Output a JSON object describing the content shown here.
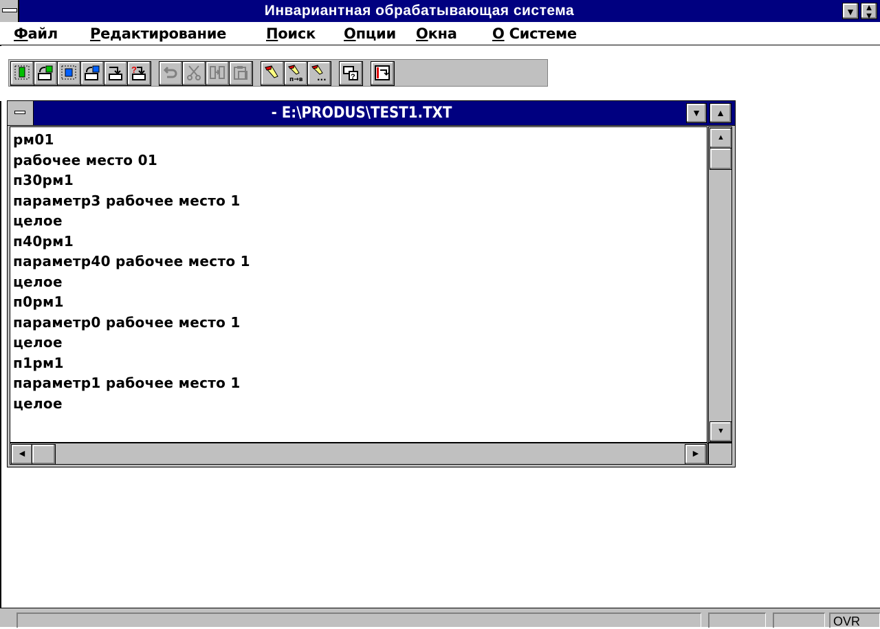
{
  "app": {
    "title": "Инвариантная обрабатывающая система"
  },
  "menu": [
    {
      "hotkey": "Ф",
      "rest": "айл"
    },
    {
      "hotkey": "Р",
      "rest": "едактирование"
    },
    {
      "hotkey": "П",
      "rest": "оиск"
    },
    {
      "hotkey": "О",
      "rest": "пции"
    },
    {
      "hotkey": "О",
      "rest": "кна"
    },
    {
      "hotkey": "О",
      "rest": " Системе"
    }
  ],
  "toolbar": {
    "buttons": [
      {
        "icon": "new-green-icon"
      },
      {
        "icon": "open-green-icon"
      },
      {
        "icon": "new-blue-icon"
      },
      {
        "icon": "open-blue-icon"
      },
      {
        "icon": "save-arrow-icon"
      },
      {
        "icon": "save-as-question-icon"
      },
      {
        "icon": "undo-icon"
      },
      {
        "icon": "cut-icon"
      },
      {
        "icon": "copy-icon"
      },
      {
        "icon": "paste-icon"
      },
      {
        "icon": "find-icon"
      },
      {
        "icon": "replace-icon",
        "label": "п→в"
      },
      {
        "icon": "find-next-icon",
        "label": "..."
      },
      {
        "icon": "help-icon"
      },
      {
        "icon": "settings-icon"
      }
    ]
  },
  "document": {
    "title": "- E:\\PRODUS\\TEST1.TXT",
    "lines": [
      "рм01",
      "рабочее место 01",
      "п30рм1",
      "параметр3 рабочее место 1",
      "целое",
      "п40рм1",
      "параметр40 рабочее место 1",
      "целое",
      "п0рм1",
      "параметр0 рабочее место 1",
      "целое",
      "п1рм1",
      "параметр1 рабочее место 1",
      "целое"
    ]
  },
  "statusbar": {
    "ovr": "OVR"
  },
  "colors": {
    "titlebar": "#000080",
    "face": "#c0c0c0"
  }
}
